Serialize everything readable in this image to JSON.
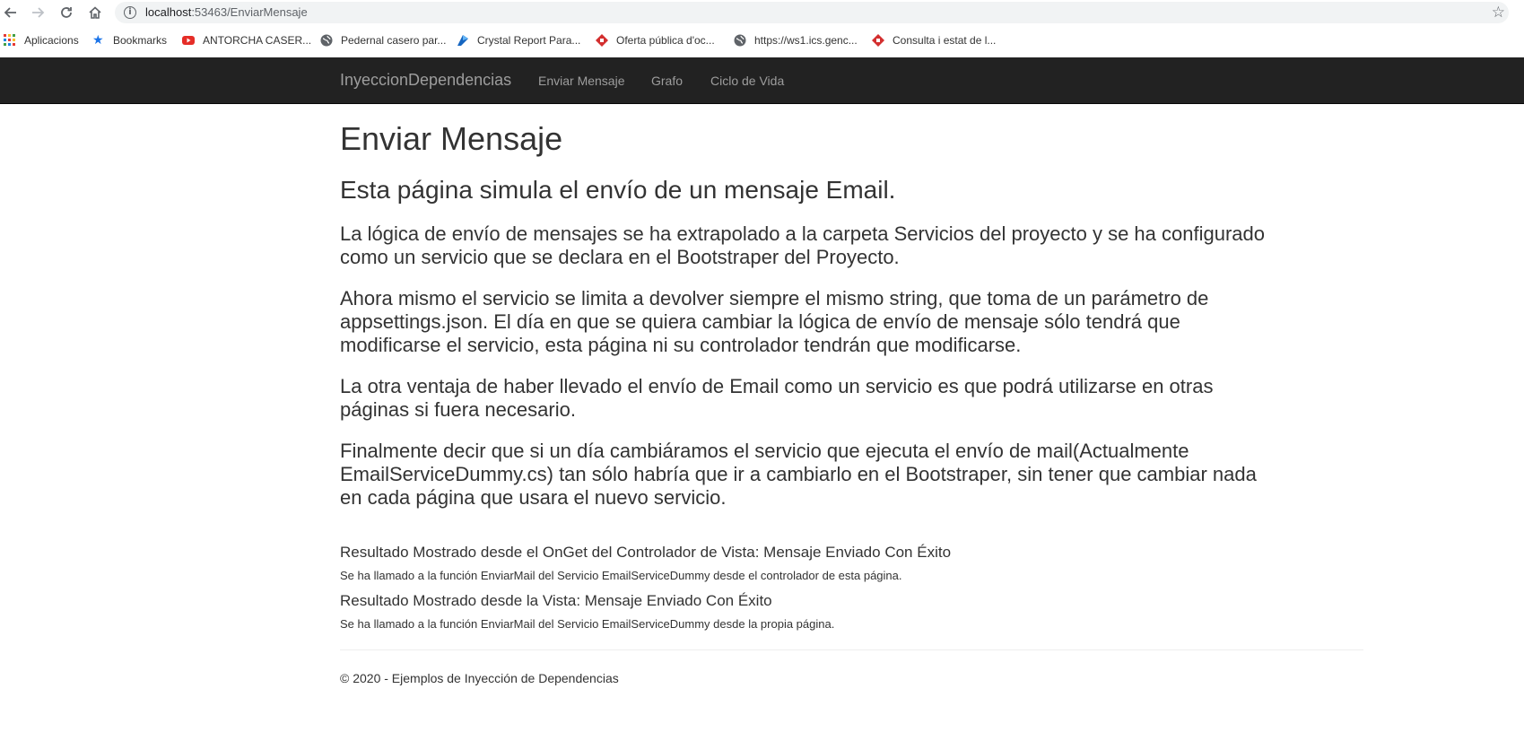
{
  "browser": {
    "url_host": "localhost",
    "url_path": ":53463/EnviarMensaje",
    "bookmarks": [
      {
        "label": "Aplicacions",
        "icon": "apps-grid-icon"
      },
      {
        "label": "Bookmarks",
        "icon": "star-icon"
      },
      {
        "label": "ANTORCHA CASER...",
        "icon": "youtube-icon"
      },
      {
        "label": "Pedernal casero par...",
        "icon": "globe-icon"
      },
      {
        "label": "Crystal Report Para...",
        "icon": "crystal-icon"
      },
      {
        "label": "Oferta pública d'oc...",
        "icon": "gencat-icon"
      },
      {
        "label": "https://ws1.ics.genc...",
        "icon": "globe-icon"
      },
      {
        "label": "Consulta i estat de l...",
        "icon": "gencat-icon"
      }
    ]
  },
  "navbar": {
    "brand": "InyeccionDependencias",
    "links": [
      "Enviar Mensaje",
      "Grafo",
      "Ciclo de Vida"
    ]
  },
  "main": {
    "title": "Enviar Mensaje",
    "subtitle": "Esta página simula el envío de un mensaje Email.",
    "paragraphs": [
      [
        "La lógica de envío de mensajes se ha extrapolado a la carpeta Servicios del proyecto y se ha configurado",
        "como un servicio que se declara en el Bootstraper del Proyecto."
      ],
      [
        "Ahora mismo el servicio se limita a devolver siempre el mismo string, que toma de un parámetro de",
        "appsettings.json. El día en que se quiera cambiar la lógica de envío de mensaje sólo tendrá que",
        "modificarse el servicio, esta página ni su controlador tendrán que modificarse."
      ],
      [
        "La otra ventaja de haber llevado el envío de Email como un servicio es que podrá utilizarse en otras",
        "páginas si fuera necesario."
      ],
      [
        "Finalmente decir que si un día cambiáramos el servicio que ejecuta el envío de mail(Actualmente",
        "EmailServiceDummy.cs) tan sólo habría que ir a cambiarlo en el Bootstraper, sin tener que cambiar nada",
        "en cada página que usara el nuevo servicio."
      ]
    ],
    "results": [
      {
        "heading": "Resultado Mostrado desde el OnGet del Controlador de Vista: Mensaje Enviado Con Éxito",
        "detail": "Se ha llamado a la función EnviarMail del Servicio EmailServiceDummy desde el controlador de esta página."
      },
      {
        "heading": "Resultado Mostrado desde la Vista: Mensaje Enviado Con Éxito",
        "detail": "Se ha llamado a la función EnviarMail del Servicio EmailServiceDummy desde la propia página."
      }
    ]
  },
  "footer": {
    "text": "© 2020 - Ejemplos de Inyección de Dependencias"
  },
  "colors": {
    "navbar_bg": "#222222",
    "nav_text": "#9d9d9d",
    "body_text": "#333333"
  }
}
